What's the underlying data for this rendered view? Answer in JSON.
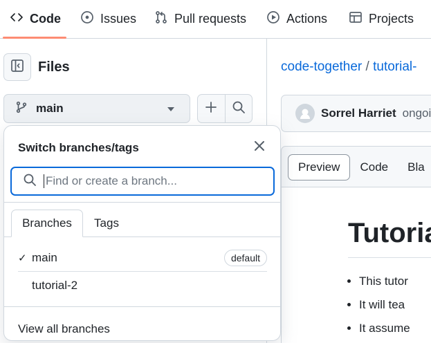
{
  "nav": {
    "tabs": [
      {
        "label": "Code",
        "icon": "code-icon"
      },
      {
        "label": "Issues",
        "icon": "issue-opened-icon"
      },
      {
        "label": "Pull requests",
        "icon": "git-pull-request-icon"
      },
      {
        "label": "Actions",
        "icon": "play-icon"
      },
      {
        "label": "Projects",
        "icon": "table-icon"
      }
    ],
    "active_color": "#fd8c73"
  },
  "files_panel": {
    "title": "Files",
    "branch": "main"
  },
  "branch_dropdown": {
    "title": "Switch branches/tags",
    "search_placeholder": "Find or create a branch...",
    "tabs": [
      "Branches",
      "Tags"
    ],
    "branches": [
      {
        "name": "main",
        "selected": true,
        "badge": "default"
      },
      {
        "name": "tutorial-2",
        "selected": false,
        "badge": ""
      }
    ],
    "checkmark": "✓",
    "footer_link": "View all branches"
  },
  "main": {
    "breadcrumb": {
      "owner": "code-together",
      "separator": "/",
      "repo": "tutorial-"
    },
    "commit": {
      "author": "Sorrel Harriet",
      "message": "ongoi"
    },
    "view_tabs": [
      "Preview",
      "Code",
      "Bla"
    ],
    "heading": "Tutoria",
    "bullets": [
      "This tutor",
      "It will tea",
      "It assume"
    ]
  },
  "colors": {
    "link": "#0969da",
    "focus": "#0969da",
    "border": "#d0d7de"
  }
}
